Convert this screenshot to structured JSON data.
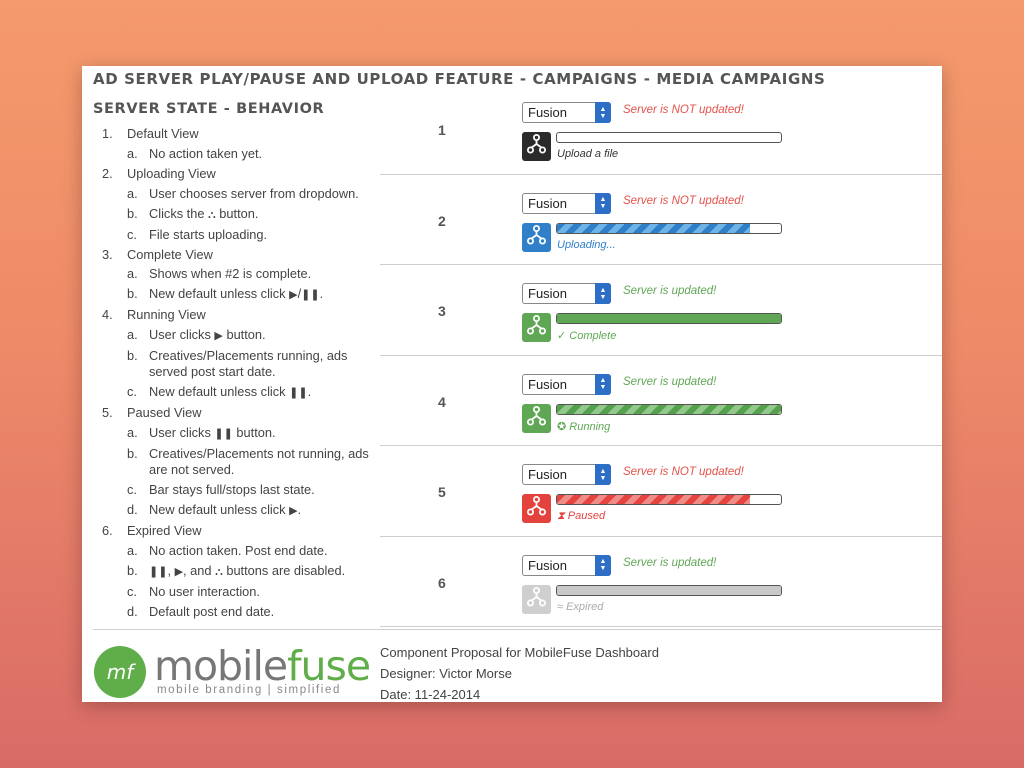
{
  "title": "AD SERVER PLAY/PAUSE AND UPLOAD FEATURE - CAMPAIGNS - MEDIA CAMPAIGNS",
  "section_title": "SERVER STATE - BEHAVIOR",
  "steps": [
    {
      "num": "1.",
      "label": "Default View"
    },
    {
      "num": "2.",
      "label": "Uploading View"
    },
    {
      "num": "3.",
      "label": "Complete View"
    },
    {
      "num": "4.",
      "label": "Running View"
    },
    {
      "num": "5.",
      "label": "Paused View"
    },
    {
      "num": "6.",
      "label": "Expired View"
    }
  ],
  "subs": {
    "s1a": "No action taken yet.",
    "s2a": "User chooses server from dropdown.",
    "s2b_pre": "Clicks the",
    "s2b_post": "button.",
    "s2c": "File starts uploading.",
    "s3a": "Shows when #2 is complete.",
    "s3b_pre": "New default unless click",
    "s3b_post": ".",
    "s4a_pre": "User clicks",
    "s4a_post": "button.",
    "s4b": "Creatives/Placements running, ads served post start date.",
    "s4c_pre": "New default unless click",
    "s4c_post": ".",
    "s5a_pre": "User clicks",
    "s5a_post": "button.",
    "s5b": "Creatives/Placements not running, ads are not served.",
    "s5c": "Bar stays full/stops last state.",
    "s5d_pre": "New default unless click",
    "s5d_post": ".",
    "s6a": "No action taken. Post end date.",
    "s6b_post": "buttons are disabled.",
    "s6b_sep1": ",",
    "s6b_sep2": ", and",
    "s6c": "No user interaction.",
    "s6d": "Default post end date."
  },
  "letters": {
    "a": "a.",
    "b": "b.",
    "c": "c.",
    "d": "d."
  },
  "glyphs": {
    "upload": "⛬",
    "play": "▶",
    "pause": "❚❚",
    "slash": "/"
  },
  "states": [
    {
      "num": "1",
      "select": "Fusion",
      "status": "Server is NOT updated!",
      "status_color": "#e4524b",
      "icon_bg": "#2b2b2b",
      "progress": 0,
      "bar_style": "none",
      "label": "Upload a file",
      "label_color": "#333"
    },
    {
      "num": "2",
      "select": "Fusion",
      "status": "Server is NOT updated!",
      "status_color": "#e4524b",
      "icon_bg": "#2f7fc9",
      "progress": 0.86,
      "bar_style": "stripes-blue",
      "label": "Uploading...",
      "label_color": "#2f7fc9"
    },
    {
      "num": "3",
      "select": "Fusion",
      "status": "Server is updated!",
      "status_color": "#5fa755",
      "icon_bg": "#5fa755",
      "progress": 1,
      "bar_style": "solid-green",
      "label": "✓ Complete",
      "label_color": "#5fa755"
    },
    {
      "num": "4",
      "select": "Fusion",
      "status": "Server is updated!",
      "status_color": "#5fa755",
      "icon_bg": "#5fa755",
      "progress": 1,
      "bar_style": "stripes-green",
      "label": "✪ Running",
      "label_color": "#5fa755"
    },
    {
      "num": "5",
      "select": "Fusion",
      "status": "Server is NOT updated!",
      "status_color": "#e4524b",
      "icon_bg": "#e4433d",
      "progress": 0.86,
      "bar_style": "stripes-red",
      "label": "⧗ Paused",
      "label_color": "#e4433d"
    },
    {
      "num": "6",
      "select": "Fusion",
      "status": "Server is updated!",
      "status_color": "#5fa755",
      "icon_bg": "#cfcfcf",
      "progress": 1,
      "bar_style": "solid-gray",
      "label": "≈ Expired",
      "label_color": "#aaa"
    }
  ],
  "footer": {
    "logo_mark": "mf",
    "logo_word_a": "mobile",
    "logo_word_b": "fuse",
    "logo_tag": "mobile branding | simplified",
    "line1": "Component Proposal for MobileFuse Dashboard",
    "line2": "Designer: Victor Morse",
    "line3": "Date: 11-24-2014"
  }
}
